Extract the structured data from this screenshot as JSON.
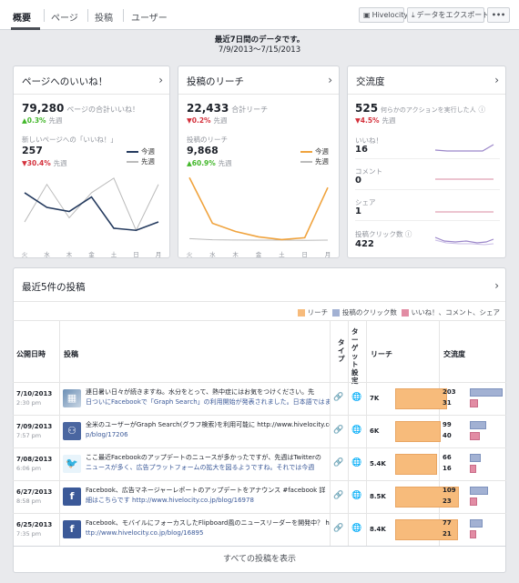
{
  "nav": {
    "tabs": [
      "概要",
      "ページ",
      "投稿",
      "ユーザー"
    ],
    "hivelocity_label": "Hivelocity",
    "export_label": "データをエクスポート",
    "more_label": "•••"
  },
  "banner": {
    "title": "最近7日間のデータです。",
    "range": "7/9/2013〜7/15/2013"
  },
  "likes_card": {
    "title": "ページへのいいね！",
    "total": "79,280",
    "total_label": "ページの合計いいね！",
    "total_change": "▲0.3%",
    "total_change_label": "先週",
    "sub_label": "新しいページへの「いいね！」",
    "sub_value": "257",
    "sub_change": "▼30.4%",
    "sub_change_label": "先週",
    "legend_this": "今週",
    "legend_last": "先週"
  },
  "reach_card": {
    "title": "投稿のリーチ",
    "total": "22,433",
    "total_label": "合計リーチ",
    "total_change": "▼0.2%",
    "total_change_label": "先週",
    "sub_label": "投稿のリーチ",
    "sub_value": "9,868",
    "sub_change": "▲60.9%",
    "sub_change_label": "先週",
    "legend_this": "今週",
    "legend_last": "先週"
  },
  "engagement_card": {
    "title": "交流度",
    "total": "525",
    "total_label": "何らかのアクションを実行した人",
    "total_change": "▼4.5%",
    "total_change_label": "先週",
    "metrics": [
      {
        "label": "いいね！",
        "value": "16"
      },
      {
        "label": "コメント",
        "value": "0"
      },
      {
        "label": "シェア",
        "value": "1"
      },
      {
        "label": "投稿クリック数",
        "value": "422"
      }
    ]
  },
  "weekdays": [
    "火",
    "水",
    "木",
    "金",
    "土",
    "日",
    "月"
  ],
  "chart_data": [
    {
      "type": "line",
      "x": [
        "火",
        "水",
        "木",
        "金",
        "土",
        "日",
        "月"
      ],
      "series": [
        {
          "name": "今週",
          "values": [
            12,
            8.5,
            7.5,
            11,
            3.5,
            3,
            5
          ]
        },
        {
          "name": "先週",
          "values": [
            5,
            14,
            6,
            12,
            15.5,
            3,
            14
          ]
        }
      ]
    },
    {
      "type": "line",
      "x": [
        "火",
        "水",
        "木",
        "金",
        "土",
        "日",
        "月"
      ],
      "series": [
        {
          "name": "今週",
          "values": [
            4600,
            1380,
            800,
            420,
            230,
            360,
            3900
          ]
        },
        {
          "name": "先週",
          "values": [
            300,
            220,
            200,
            190,
            190,
            180,
            190
          ]
        }
      ]
    }
  ],
  "posts": {
    "title": "最近5件の投稿",
    "legend": [
      "リーチ",
      "投稿のクリック数",
      "いいね！、コメント、シェア"
    ],
    "headers": {
      "date": "公開日時",
      "post": "投稿",
      "type": "タイプ",
      "targeting": "ターゲット設定",
      "reach": "リーチ",
      "engagement": "交流度"
    },
    "rows": [
      {
        "date": "7/10/2013",
        "time": "2:30 pm",
        "line1": "連日暑い日々が続きますね。水分をとって、熱中症にはお気をつけください。先",
        "line2": "日ついにFacebookで「Graph Search」の利用開始が発表されました。日本語ではま",
        "reach": "7K",
        "reach_pct": 0.82,
        "clicks": "203",
        "likes": "31",
        "clicks_pct": 0.95,
        "likes_pct": 0.12
      },
      {
        "date": "7/09/2013",
        "time": "7:57 pm",
        "line1": "全米のユーザーがGraph Search(グラフ検索)を利用可能に http://www.hivelocity.co.j",
        "line2": "p/blog/17206",
        "reach": "6K",
        "reach_pct": 0.72,
        "clicks": "99",
        "likes": "40",
        "clicks_pct": 0.47,
        "likes_pct": 0.18
      },
      {
        "date": "7/08/2013",
        "time": "6:06 pm",
        "line1": "ここ最近Facebookのアップデートのニュースが多かったですが、先週はTwitterの",
        "line2": "ニュースが多く、広告プラットフォームの拡大を図るようですね。それでは今週",
        "reach": "5.4K",
        "reach_pct": 0.66,
        "clicks": "66",
        "likes": "16",
        "clicks_pct": 0.32,
        "likes_pct": 0.08
      },
      {
        "date": "6/27/2013",
        "time": "8:58 pm",
        "line1": "Facebook、広告マネージャーレポートのアップデートをアナウンス #facebook 詳",
        "line2": "細はこちらです http://www.hivelocity.co.jp/blog/16978",
        "reach": "8.5K",
        "reach_pct": 1.0,
        "clicks": "109",
        "likes": "23",
        "clicks_pct": 0.52,
        "likes_pct": 0.1
      },
      {
        "date": "6/25/2013",
        "time": "7:35 pm",
        "line1": "Facebook、モバイルにフォーカスしたFlipboard風のニュースリーダーを開発中？ h",
        "line2": "ttp://www.hivelocity.co.jp/blog/16895",
        "reach": "8.4K",
        "reach_pct": 0.98,
        "clicks": "77",
        "likes": "21",
        "clicks_pct": 0.37,
        "likes_pct": 0.09
      }
    ],
    "view_all": "すべての投稿を表示"
  },
  "colors": {
    "reach": "#f7bb7b",
    "clicks": "#a2b1d3",
    "likes": "#e28ca4",
    "this_week_likes": "#243a5e",
    "this_week_reach": "#f0a33d",
    "spark": "#9b86c9"
  }
}
